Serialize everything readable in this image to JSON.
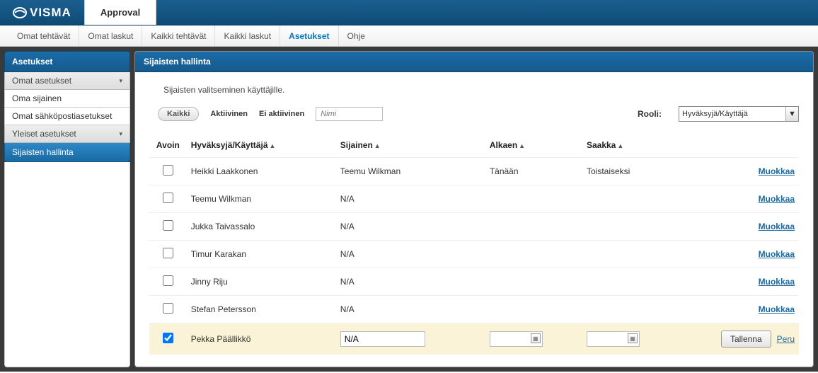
{
  "app": {
    "brand": "VISMA",
    "module": "Approval"
  },
  "subnav": {
    "omat_tehtavat": "Omat tehtävät",
    "omat_laskut": "Omat laskut",
    "kaikki_tehtavat": "Kaikki tehtävät",
    "kaikki_laskut": "Kaikki laskut",
    "asetukset": "Asetukset",
    "ohje": "Ohje"
  },
  "sidebar": {
    "title": "Asetukset",
    "section_omat": "Omat asetukset",
    "sub_oma_sijainen": "Oma sijainen",
    "sub_omat_sahkoposti": "Omat sähköpostiasetukset",
    "section_yleiset": "Yleiset asetukset",
    "active_sijaisten": "Sijaisten hallinta"
  },
  "panel": {
    "title": "Sijaisten hallinta",
    "desc": "Sijaisten valitseminen käyttäjille.",
    "filter_all": "Kaikki",
    "filter_active": "Aktiivinen",
    "filter_inactive": "Ei aktiivinen",
    "name_placeholder": "Nimi",
    "role_label": "Rooli:",
    "role_value": "Hyväksyjä/Käyttäjä"
  },
  "columns": {
    "avoin": "Avoin",
    "approver": "Hyväksyjä/Käyttäjä",
    "sijainen": "Sijainen",
    "alkaen": "Alkaen",
    "saakka": "Saakka"
  },
  "rows": [
    {
      "approver": "Heikki Laakkonen",
      "sijainen": "Teemu Wilkman",
      "alkaen": "Tänään",
      "saakka": "Toistaiseksi",
      "action": "Muokkaa"
    },
    {
      "approver": "Teemu Wilkman",
      "sijainen": "N/A",
      "alkaen": "",
      "saakka": "",
      "action": "Muokkaa"
    },
    {
      "approver": "Jukka Taivassalo",
      "sijainen": "N/A",
      "alkaen": "",
      "saakka": "",
      "action": "Muokkaa"
    },
    {
      "approver": "Timur Karakan",
      "sijainen": "N/A",
      "alkaen": "",
      "saakka": "",
      "action": "Muokkaa"
    },
    {
      "approver": "Jinny Riju",
      "sijainen": "N/A",
      "alkaen": "",
      "saakka": "",
      "action": "Muokkaa"
    },
    {
      "approver": "Stefan Petersson",
      "sijainen": "N/A",
      "alkaen": "",
      "saakka": "",
      "action": "Muokkaa"
    }
  ],
  "edit_row": {
    "approver": "Pekka Päällikkö",
    "sijainen_value": "N/A",
    "save": "Tallenna",
    "cancel": "Peru"
  }
}
